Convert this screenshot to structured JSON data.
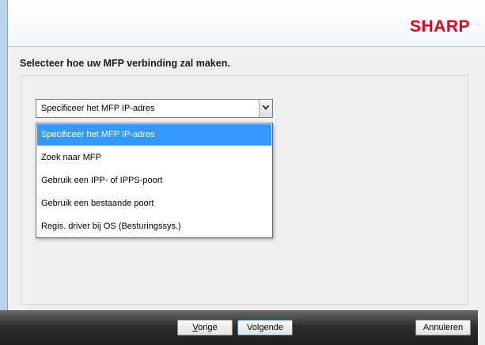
{
  "header": {
    "logo_text": "SHARP",
    "brand_color": "#e6001b"
  },
  "instruction": "Selecteer hoe uw MFP verbinding zal maken.",
  "combo": {
    "selected_value": "Specificeer het MFP IP-adres",
    "options": [
      "Specificeer het MFP IP-adres",
      "Zoek naar MFP",
      "Gebruik een IPP- of IPPS-poort",
      "Gebruik een bestaande poort",
      "Regis. driver bij OS (Besturingssys.)"
    ],
    "highlight_color": "#3399ff"
  },
  "buttons": {
    "prev_mnemonic": "V",
    "prev_rest": "orige",
    "next_pre": "Vol",
    "next_mnemonic": "g",
    "next_rest": "ende",
    "cancel": "Annuleren"
  }
}
